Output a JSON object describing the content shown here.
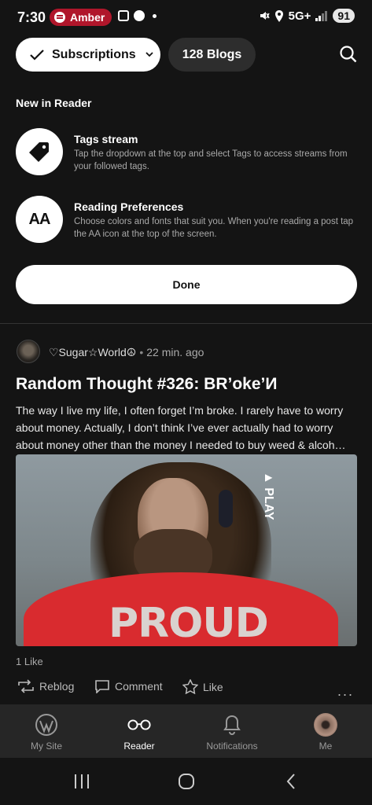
{
  "status_bar": {
    "time": "7:30",
    "pill_label": "Amber",
    "network": "5G+",
    "battery": "91"
  },
  "header": {
    "subscriptions_label": "Subscriptions",
    "blogs_label": "128 Blogs",
    "search_icon": "search-icon"
  },
  "new_in_reader": {
    "title": "New in Reader",
    "tips": [
      {
        "icon": "tag-icon",
        "title": "Tags stream",
        "description": "Tap the dropdown at the top and select Tags to access streams from your followed tags."
      },
      {
        "icon": "aa-icon",
        "icon_text": "AA",
        "title": "Reading Preferences",
        "description": "Choose colors and fonts that suit you. When you're reading a post tap the AA icon at the top of the screen."
      }
    ],
    "done_label": "Done"
  },
  "post": {
    "author": "♡Sugar☆World☮",
    "time": "22 min. ago",
    "title": "Random Thought #326: BR’oke’И",
    "excerpt": "The way I live my life, I often forget I’m broke. I rarely have to worry about money. Actually, I don’t think I’ve ever actually had to worry about money other than the money I needed to buy weed & alcoh…",
    "image_text": {
      "shirt": "PROUD",
      "play": "▲ PLAY"
    },
    "likes": "1 Like",
    "actions": {
      "reblog": "Reblog",
      "comment": "Comment",
      "like": "Like",
      "more": "..."
    }
  },
  "bottom_nav": [
    {
      "label": "My Site",
      "icon": "wordpress-icon",
      "active": false
    },
    {
      "label": "Reader",
      "icon": "glasses-icon",
      "active": true
    },
    {
      "label": "Notifications",
      "icon": "bell-icon",
      "active": false
    },
    {
      "label": "Me",
      "icon": "avatar",
      "active": false
    }
  ],
  "colors": {
    "background": "#141414",
    "pill": "#b0162b",
    "nav_background": "#262626"
  }
}
